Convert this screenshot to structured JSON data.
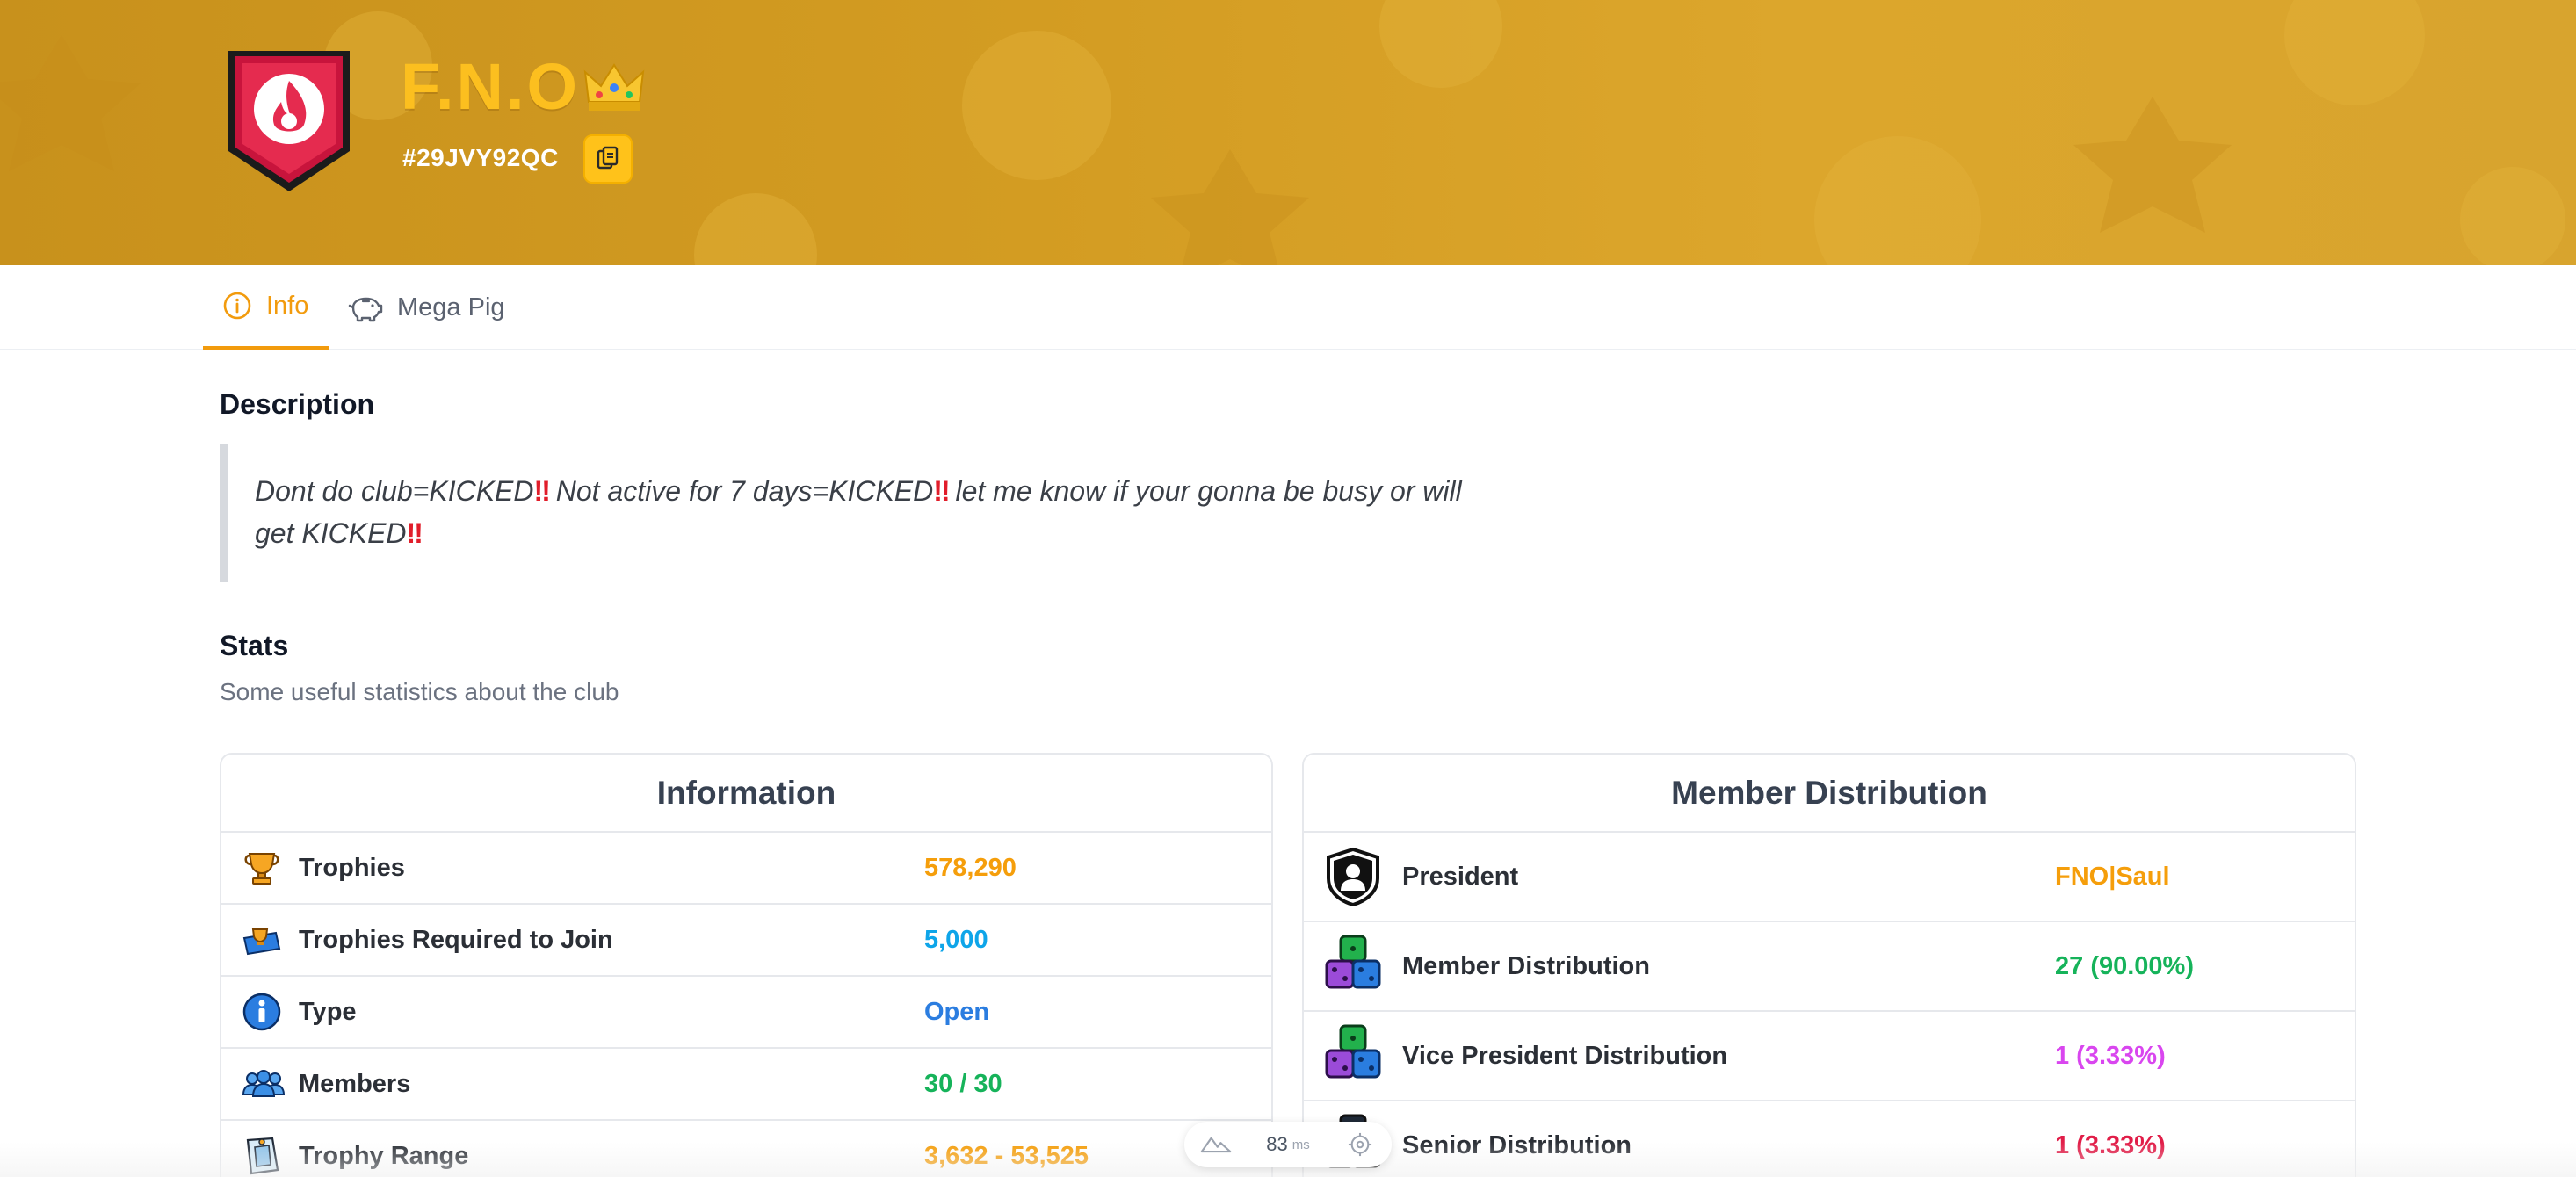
{
  "club": {
    "name": "F.N.O",
    "tag": "#29JVY92QC"
  },
  "tabs": [
    {
      "label": "Info",
      "icon": "info-icon",
      "active": true
    },
    {
      "label": "Mega Pig",
      "icon": "piggy-bank-icon",
      "active": false
    }
  ],
  "description": {
    "heading": "Description",
    "parts": [
      "Dont do club=KICKED",
      " Not active for 7 days=KICKED",
      " let me know if your gonna be busy or will get KICKED"
    ],
    "emphasis": "‼"
  },
  "stats": {
    "heading": "Stats",
    "subtitle": "Some useful statistics about the club"
  },
  "information": {
    "title": "Information",
    "rows": [
      {
        "label": "Trophies",
        "value": "578,290",
        "color": "#f59e0b",
        "icon": "trophy-icon"
      },
      {
        "label": "Trophies Required to Join",
        "value": "5,000",
        "color": "#0ea5e9",
        "icon": "trophy-requirement-icon"
      },
      {
        "label": "Type",
        "value": "Open",
        "color": "#2b7de0",
        "icon": "info-circle-icon"
      },
      {
        "label": "Members",
        "value": "30 / 30",
        "color": "#16b35a",
        "icon": "members-icon"
      },
      {
        "label": "Trophy Range",
        "value": "3,632 - 53,525",
        "color": "#f59e0b",
        "icon": "trophy-range-icon"
      }
    ]
  },
  "distribution": {
    "title": "Member Distribution",
    "rows": [
      {
        "label": "President",
        "value": "FNO|Saul",
        "color": "#f59e0b",
        "icon": "president-icon"
      },
      {
        "label": "Member Distribution",
        "value": "27 (90.00%)",
        "color": "#16b35a",
        "icon": "dice-stack-icon"
      },
      {
        "label": "Vice President Distribution",
        "value": "1 (3.33%)",
        "color": "#d946ef",
        "icon": "dice-stack-icon"
      },
      {
        "label": "Senior Distribution",
        "value": "1 (3.33%)",
        "color": "#e11d48",
        "icon": "senior-icon"
      }
    ]
  },
  "perf": {
    "value": "83",
    "unit": "ms"
  }
}
